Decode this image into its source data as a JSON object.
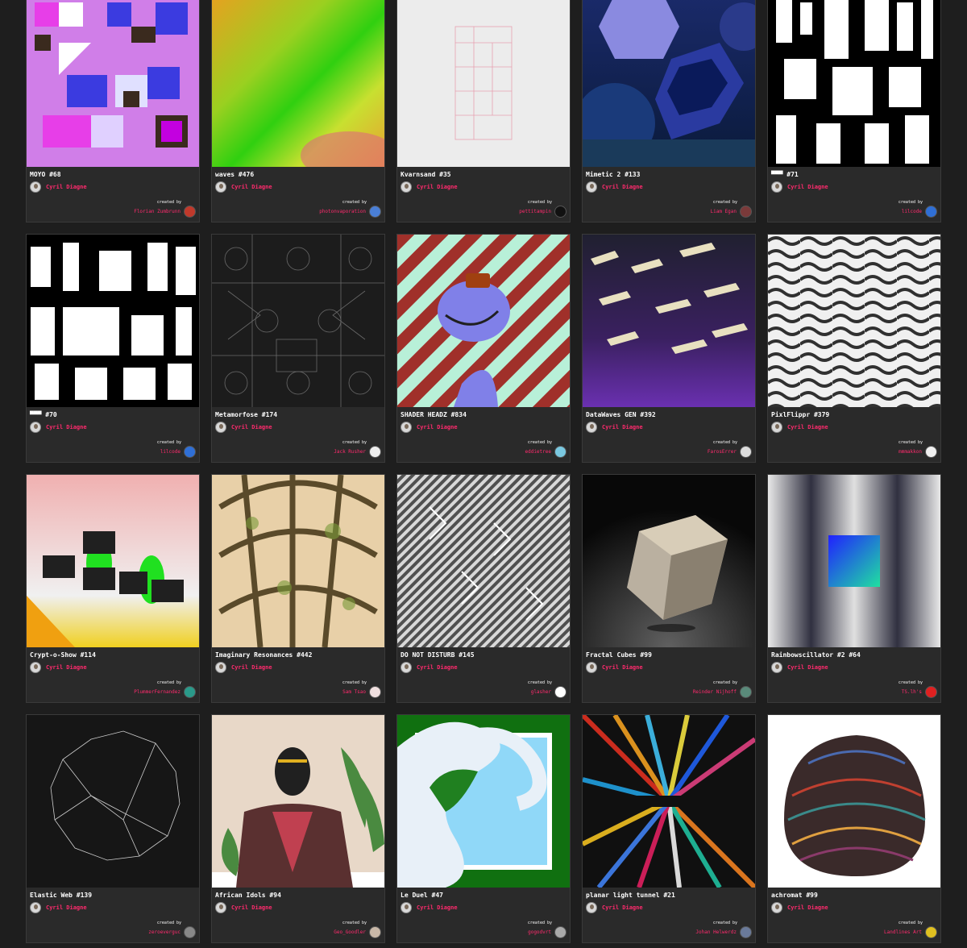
{
  "owner_name": "Cyril Diagne",
  "created_by_label": "created by",
  "colors": {
    "accent": "#ff2a6d",
    "card_bg": "#2a2a2a",
    "page_bg": "#1e1e1e"
  },
  "cards": [
    {
      "title": "MOYO #68",
      "creator": "Florian Zumbrunn",
      "creator_color": "#c0392b"
    },
    {
      "title": "waves #476",
      "creator": "photonvaporation",
      "creator_color": "#4a7fd6"
    },
    {
      "title": "Kvarnsand #35",
      "creator": "pettitampin",
      "creator_color": "#111111"
    },
    {
      "title": "Mimetic 2 #133",
      "creator": "Liam Egan",
      "creator_color": "#7a3a3a"
    },
    {
      "title": "▀▀▀ #71",
      "creator": "lilcode",
      "creator_color": "#2f6fd6"
    },
    {
      "title": "▀▀▀ #70",
      "creator": "lilcode",
      "creator_color": "#2f6fd6"
    },
    {
      "title": "Metamorfose #174",
      "creator": "Jack Rusher",
      "creator_color": "#eeeeee"
    },
    {
      "title": "SHADER HEADZ #834",
      "creator": "eddietree",
      "creator_color": "#7ac8e0"
    },
    {
      "title": "DataWaves GEN #392",
      "creator": "FarosErrer",
      "creator_color": "#dddddd"
    },
    {
      "title": "PixlFlippr #379",
      "creator": "mmmakkon",
      "creator_color": "#f0f0f0"
    },
    {
      "title": "Crypt-o-Show #114",
      "creator": "PlummerFernandez",
      "creator_color": "#2a9a8a"
    },
    {
      "title": "Imaginary Resonances #442",
      "creator": "Sam Tsao",
      "creator_color": "#f0e0e0"
    },
    {
      "title": "DO NOT DISTURB #145",
      "creator": "glasher",
      "creator_color": "#ffffff"
    },
    {
      "title": "Fractal Cubes #99",
      "creator": "Reinder Nijhoff",
      "creator_color": "#5a8a7a"
    },
    {
      "title": "Rainbowscillator #2 #64",
      "creator": "TS.lh's",
      "creator_color": "#e02020"
    },
    {
      "title": "Elastic Web #139",
      "creator": "zeroeverguc",
      "creator_color": "#888888"
    },
    {
      "title": "African Idols #94",
      "creator": "Geo_Goodler",
      "creator_color": "#c9b8a8"
    },
    {
      "title": "Le Duel #47",
      "creator": "gogodvrt",
      "creator_color": "#aaaaaa"
    },
    {
      "title": "planar light tunnel #21",
      "creator": "Johan Helwerdz",
      "creator_color": "#6a7a9a"
    },
    {
      "title": "achromat #99",
      "creator": "Landlines Art",
      "creator_color": "#e0c020"
    }
  ]
}
